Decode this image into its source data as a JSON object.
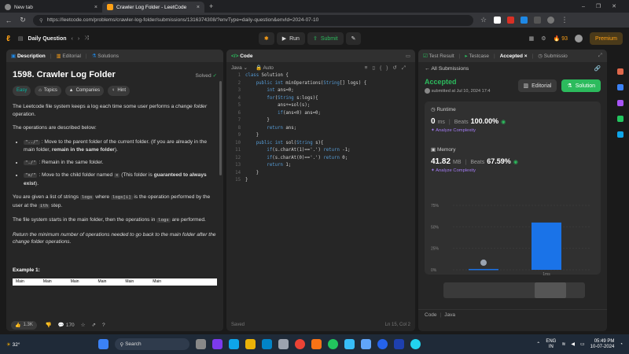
{
  "browser": {
    "tabs": [
      {
        "title": "New tab"
      },
      {
        "title": "Crawler Log Folder - LeetCode"
      }
    ],
    "url": "https://leetcode.com/problems/crawler-log-folder/submissions/1316374308/?envType=daily-question&envId=2024-07-10"
  },
  "header": {
    "daily": "Daily Question",
    "run": "Run",
    "submit": "Submit",
    "streak": "93",
    "premium": "Premium"
  },
  "desc_panel": {
    "tabs": [
      "Description",
      "Editorial",
      "Solutions"
    ],
    "title": "1598. Crawler Log Folder",
    "status": "Solved",
    "tags": [
      "Easy",
      "Topics",
      "Companies",
      "Hint"
    ],
    "p1a": "The Leetcode file system keeps a log each time some user performs a ",
    "p1b": "change folder",
    "p1c": " operation.",
    "p2": "The operations are described below:",
    "b1code": "\"../\"",
    "b1a": " : Move to the parent folder of the current folder. (If you are already in the main folder, ",
    "b1b": "remain in the same folder",
    "b1c": ").",
    "b2code": "\"./\"",
    "b2a": " : Remain in the same folder.",
    "b3code": "\"x/\"",
    "b3a": " : Move to the child folder named ",
    "b3chip": "x",
    "b3b": " (This folder is ",
    "b3c": "guaranteed to always exist",
    "b3d": ").",
    "p3a": "You are given a list of strings ",
    "p3chip1": "logs",
    "p3b": " where ",
    "p3chip2": "logs[i]",
    "p3c": " is the operation performed by the user at the ",
    "p3chip3": "ith",
    "p3d": " step.",
    "p4a": "The file system starts in the main folder, then the operations in ",
    "p4chip": "logs",
    "p4b": " are performed.",
    "p5": "Return the minimum number of operations needed to go back to the main folder after the change folder operations.",
    "example": "Example 1:",
    "table_headers": [
      "Main",
      "Main",
      "Main",
      "Main",
      "Main",
      "Main"
    ],
    "likes": "1.3K",
    "comments": "170"
  },
  "code_panel": {
    "tab": "Code",
    "lang": "Java",
    "mode": "Auto",
    "lines": [
      "class Solution {",
      "    public int minOperations(String[] logs) {",
      "        int ans=0;",
      "        for(String s:logs){",
      "            ans+=sol(s);",
      "            if(ans<0) ans=0;",
      "        }",
      "        return ans;",
      "    }",
      "    public int sol(String s){",
      "        if(s.charAt(1)=='.') return -1;",
      "        if(s.charAt(0)=='.') return 0;",
      "        return 1;",
      "    }",
      "}"
    ],
    "saved": "Saved",
    "cursor": "Ln 15, Col 2"
  },
  "result_panel": {
    "tabs": [
      "Test Result",
      "Testcase",
      "Accepted",
      "Submissio"
    ],
    "back": "All Submissions",
    "verdict": "Accepted",
    "submitted": "submitted at Jul 10, 2024 17:4",
    "editorial": "Editorial",
    "solution": "Solution",
    "runtime_label": "Runtime",
    "runtime_value": "0",
    "runtime_unit": "ms",
    "runtime_beats_label": "Beats",
    "runtime_beats": "100.00%",
    "analyze": "Analyze Complexity",
    "memory_label": "Memory",
    "memory_value": "41.82",
    "memory_unit": "MB",
    "memory_beats_label": "Beats",
    "memory_beats": "67.59%",
    "code_footer": "Code",
    "code_footer_lang": "Java"
  },
  "chart_data": {
    "type": "bar",
    "categories": [
      "",
      "1ms"
    ],
    "values": [
      1,
      55
    ],
    "yticks": [
      "75%",
      "50%",
      "25%",
      "0%"
    ],
    "ylim": [
      0,
      75
    ],
    "xlabel": "",
    "ylabel": "",
    "colors": {
      "bar": "#1a73e8"
    }
  },
  "taskbar": {
    "temp": "32°",
    "search": "Search",
    "lang1": "ENG",
    "lang2": "IN",
    "time": "05:49 PM",
    "date": "10-07-2024"
  },
  "colors": {
    "accent_green": "#2cbb5d",
    "accent_orange": "#ffa116",
    "premium": "#ffa116"
  }
}
